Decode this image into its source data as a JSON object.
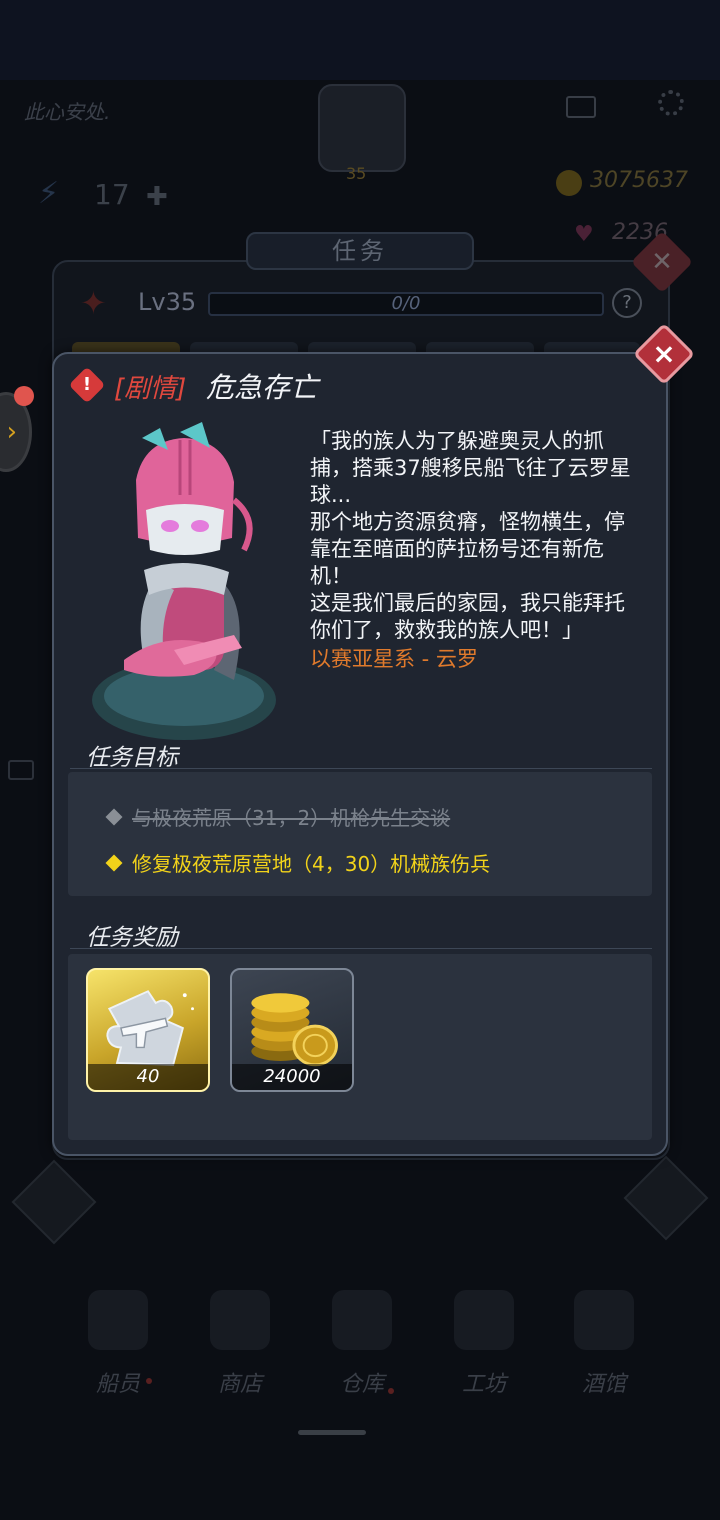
{
  "background": {
    "status_text": "此心安处.",
    "player_level": "35",
    "energy": "17",
    "gold": "3075637",
    "gems": "2236",
    "panel_title": "任务",
    "rank_level": "Lv35",
    "xp_text": "0/0",
    "xp_fraction": 0,
    "help_label": "?",
    "nav": [
      {
        "label": "船员",
        "icon": "crew-icon"
      },
      {
        "label": "商店",
        "icon": "shop-icon"
      },
      {
        "label": "仓库",
        "icon": "warehouse-icon"
      },
      {
        "label": "工坊",
        "icon": "workshop-icon"
      },
      {
        "label": "酒馆",
        "icon": "tavern-icon"
      }
    ]
  },
  "dialog": {
    "close_label": "×",
    "alert_label": "!",
    "tag": "[剧情]",
    "title": "危急存亡",
    "story_lines": [
      "「我的族人为了躲避奥灵人的抓",
      "捕，搭乘37艘移民船飞往了云罗星",
      "球...",
      "那个地方资源贫瘠，怪物横生，停",
      "靠在至暗面的萨拉杨号还有新危",
      "机！",
      "这是我们最后的家园，我只能拜托",
      "你们了，救救我的族人吧！」"
    ],
    "source": "以赛亚星系 - 云罗",
    "objectives_label": "任务目标",
    "objectives": [
      {
        "text": "与极夜荒原（31，2）机枪先生交谈",
        "status": "completed"
      },
      {
        "text": "修复极夜荒原营地（4，30）机械族伤兵",
        "status": "active"
      }
    ],
    "rewards_label": "任务奖励",
    "rewards": [
      {
        "icon": "weapon-fragment-icon",
        "count": "40"
      },
      {
        "icon": "gold-coins-icon",
        "count": "24000"
      }
    ]
  },
  "colors": {
    "accent_red": "#e0483e",
    "objective_active": "#f2d31a",
    "source_orange": "#e07a2c"
  }
}
